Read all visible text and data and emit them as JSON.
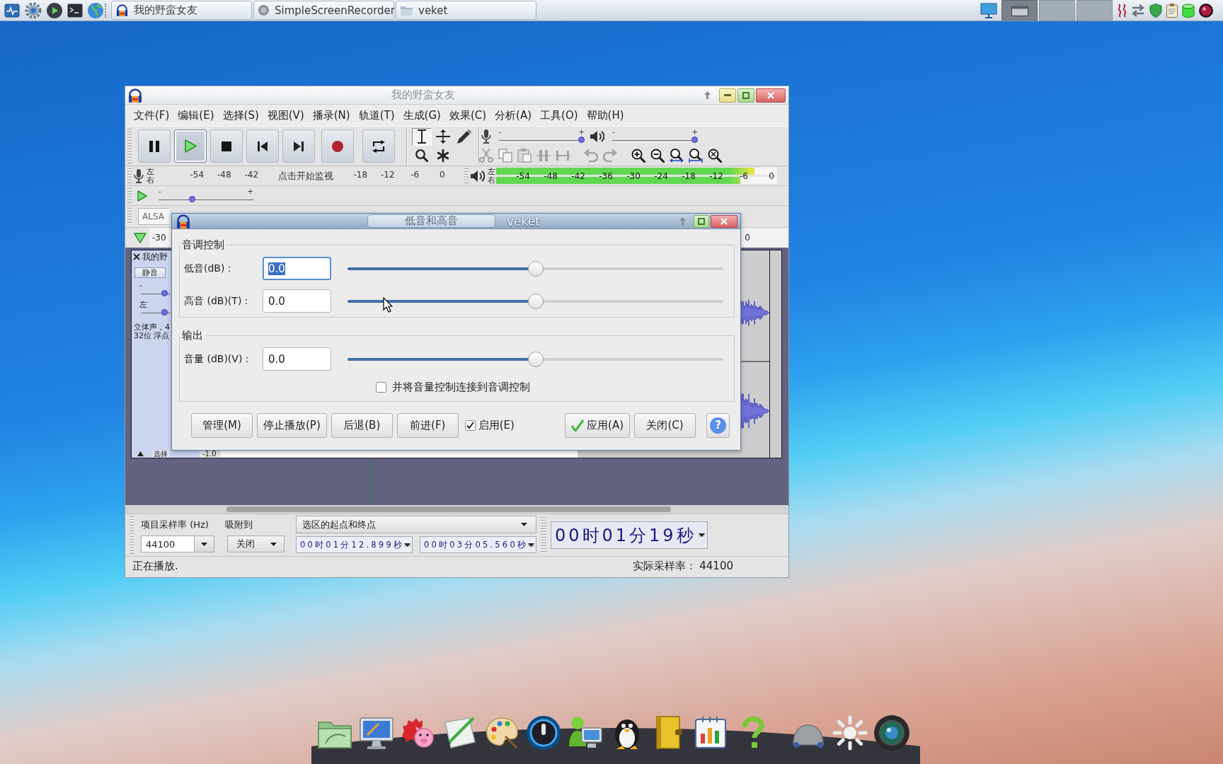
{
  "taskbar": {
    "tasks": [
      {
        "label": "我的野蛮女友"
      },
      {
        "label": "SimpleScreenRecorder"
      },
      {
        "label": "veket"
      }
    ],
    "workspaces": [
      {
        "selected": true
      },
      {
        "selected": false
      },
      {
        "selected": false
      }
    ]
  },
  "audacity": {
    "title": "我的野蛮女友",
    "menus": [
      "文件(F)",
      "编辑(E)",
      "选择(S)",
      "视图(V)",
      "播录(N)",
      "轨道(T)",
      "生成(G)",
      "效果(C)",
      "分析(A)",
      "工具(O)",
      "帮助(H)"
    ],
    "transport": [
      {
        "kind": "pause",
        "pressed": false
      },
      {
        "kind": "play",
        "pressed": true
      },
      {
        "kind": "stop",
        "pressed": false
      },
      {
        "kind": "skip-start",
        "pressed": false
      },
      {
        "kind": "skip-end",
        "pressed": false
      },
      {
        "kind": "record",
        "pressed": false
      },
      {
        "kind": "loop",
        "pressed": false
      }
    ],
    "tools": [
      {
        "kind": "select",
        "selected": true
      },
      {
        "kind": "envelope",
        "selected": false
      },
      {
        "kind": "draw",
        "selected": false
      },
      {
        "kind": "zoom",
        "selected": false
      },
      {
        "kind": "multi",
        "selected": false
      }
    ],
    "mixer": {
      "recording": {
        "min_label": "-",
        "max_label": "+",
        "level": 1
      },
      "playback": {
        "min_label": "-",
        "max_label": "+",
        "level": 1
      }
    },
    "edit_tools": [
      {
        "kind": "cut",
        "disabled": true
      },
      {
        "kind": "copy",
        "disabled": true
      },
      {
        "kind": "paste",
        "disabled": true
      },
      {
        "kind": "trim",
        "disabled": true
      },
      {
        "kind": "silence",
        "disabled": true
      },
      {
        "kind": "undo",
        "disabled": true
      },
      {
        "kind": "redo",
        "disabled": true
      },
      {
        "kind": "zoom-in",
        "disabled": false
      },
      {
        "kind": "zoom-out",
        "disabled": false
      },
      {
        "kind": "fit-selection",
        "disabled": false
      },
      {
        "kind": "fit-project",
        "disabled": false
      },
      {
        "kind": "zoom-toggle",
        "disabled": false
      }
    ],
    "record_meter": {
      "channels": [
        "左",
        "右"
      ],
      "ticks_before": [
        "-54",
        "-48",
        "-42"
      ],
      "monitor_label": "点击开始监视",
      "ticks_after": [
        "-18",
        "-12",
        "-6",
        "0"
      ]
    },
    "play_meter": {
      "channels": [
        {
          "label": "左",
          "level": 0.92
        },
        {
          "label": "右",
          "level": 0.87
        }
      ],
      "ticks": [
        "-54",
        "-48",
        "-42",
        "-36",
        "-30",
        "-24",
        "-18",
        "-12",
        "-6",
        "0"
      ]
    },
    "play_at_speed": {
      "min_label": "-",
      "max_label": "+",
      "level": 0.34
    },
    "device": {
      "host": "ALSA"
    },
    "ruler": {
      "start_label": "-30",
      "end_label": "0"
    },
    "track": {
      "name": "我的野",
      "mute": "静音",
      "gain": {
        "label": "-",
        "level": 0.88
      },
      "pan": {
        "label": "左",
        "level": 0.88
      },
      "info": [
        "立体声，4",
        "32位 浮点"
      ],
      "select": "选择",
      "scale_label": "-1.0"
    },
    "selection_bar": {
      "rate_label": "项目采样率 (Hz)",
      "rate": "44100",
      "snap_label": "吸附到",
      "snap": "关闭",
      "mode": "选区的起点和终点",
      "start": "00时01分12.899秒",
      "end": "00时03分05.560秒",
      "position": "00时01分19秒"
    },
    "status_bar": {
      "message": "正在播放.",
      "rate": "实际采样率： 44100"
    }
  },
  "dialog": {
    "title": "低音和高音",
    "title_suffix": "veket",
    "groups": [
      {
        "label": "音调控制",
        "rows": [
          {
            "label": "低音(dB)：",
            "value": "0.0",
            "focused": true,
            "level": 0.5
          },
          {
            "label": "高音 (dB)(T)：",
            "value": "0.0",
            "focused": false,
            "level": 0.5
          }
        ]
      },
      {
        "label": "输出",
        "rows": [
          {
            "label": "音量 (dB)(V)：",
            "value": "0.0",
            "focused": false,
            "level": 0.5
          }
        ],
        "checkbox": {
          "label": "并将音量控制连接到音调控制",
          "checked": false
        }
      }
    ],
    "buttons": [
      {
        "kind": "button",
        "label": "管理(M)"
      },
      {
        "kind": "button",
        "label": "停止播放(P)"
      },
      {
        "kind": "button",
        "label": "后退(B)"
      },
      {
        "kind": "button",
        "label": "前进(F)"
      },
      {
        "kind": "checkbox",
        "label": "启用(E)",
        "checked": true
      },
      {
        "kind": "apply",
        "label": "应用(A)"
      },
      {
        "kind": "button",
        "label": "关闭(C)"
      },
      {
        "kind": "help",
        "label": "?"
      }
    ]
  }
}
